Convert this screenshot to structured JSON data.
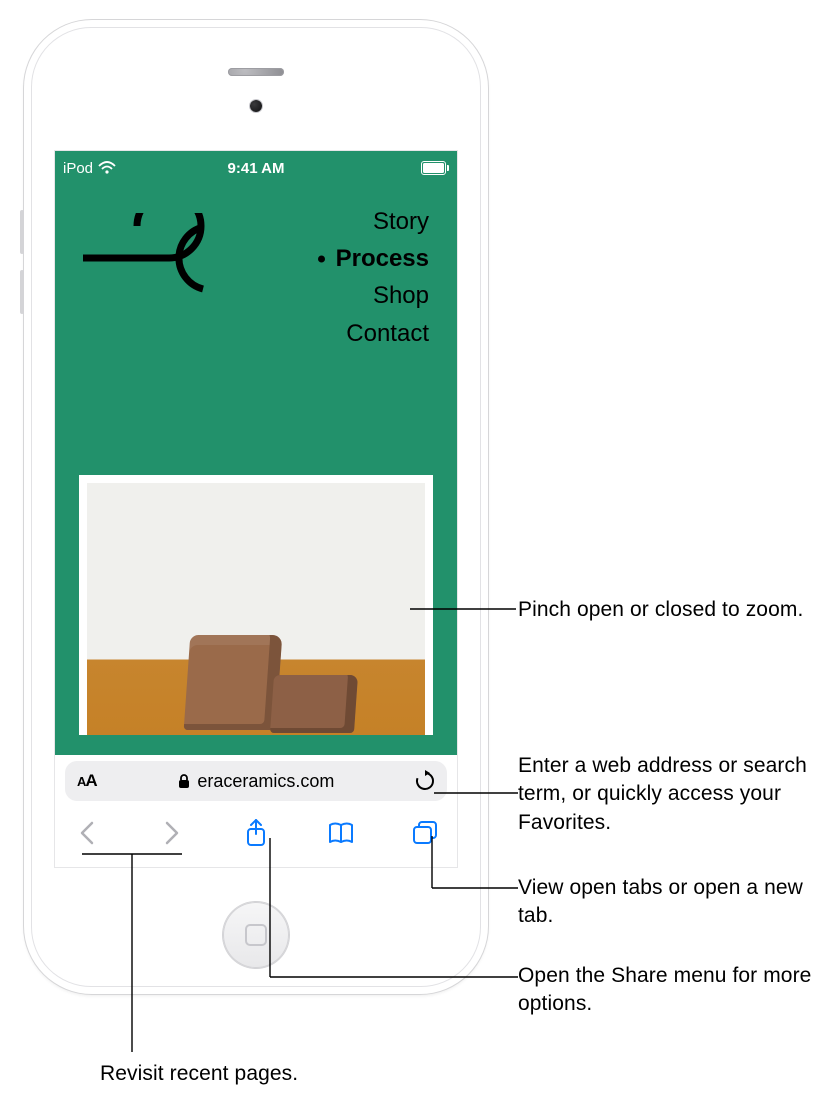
{
  "status_bar": {
    "device_label": "iPod",
    "time": "9:41 AM"
  },
  "webpage": {
    "nav_items": [
      "Story",
      "Process",
      "Shop",
      "Contact"
    ],
    "active_nav": "Process"
  },
  "address_bar": {
    "text_size_label": "AA",
    "domain": "eraceramics.com"
  },
  "callouts": {
    "pinch": "Pinch open or closed to zoom.",
    "address": "Enter a web address or search term, or quickly access your Favorites.",
    "tabs": "View open tabs or open a new tab.",
    "share": "Open the Share menu for more options.",
    "history": "Revisit recent pages."
  }
}
